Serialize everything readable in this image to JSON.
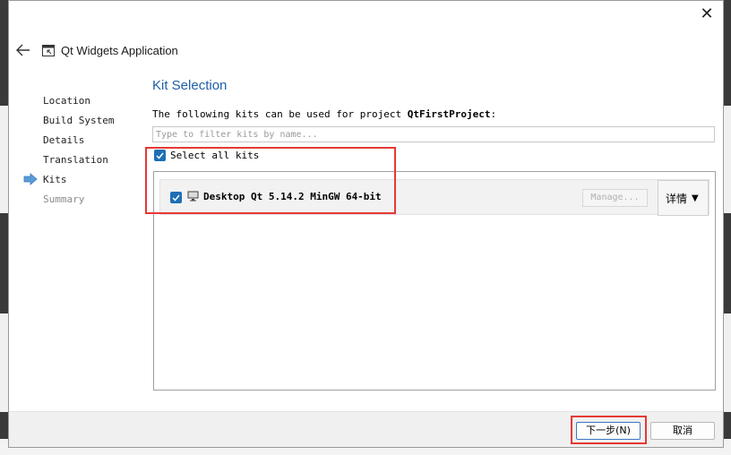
{
  "window": {
    "title": "Qt Widgets Application",
    "close_symbol": "✕"
  },
  "steps": [
    {
      "label": "Location",
      "state": "done"
    },
    {
      "label": "Build System",
      "state": "done"
    },
    {
      "label": "Details",
      "state": "done"
    },
    {
      "label": "Translation",
      "state": "done"
    },
    {
      "label": "Kits",
      "state": "current"
    },
    {
      "label": "Summary",
      "state": "pending"
    }
  ],
  "page": {
    "title": "Kit Selection",
    "description_prefix": "The following kits can be used for project ",
    "project_name": "QtFirstProject",
    "description_suffix": ":"
  },
  "filter": {
    "placeholder": "Type to filter kits by name...",
    "value": ""
  },
  "select_all": {
    "label": "Select all kits",
    "checked": true
  },
  "kits": [
    {
      "name": "Desktop Qt 5.14.2 MinGW 64-bit",
      "checked": true,
      "manage_label": "Manage...",
      "details_label": "详情",
      "details_caret": "▼"
    }
  ],
  "footer": {
    "next_label": "下一步(N)",
    "cancel_label": "取消"
  },
  "colors": {
    "accent": "#1f6fb5",
    "title_blue": "#1f5fa8",
    "highlight_red": "#e53935"
  }
}
